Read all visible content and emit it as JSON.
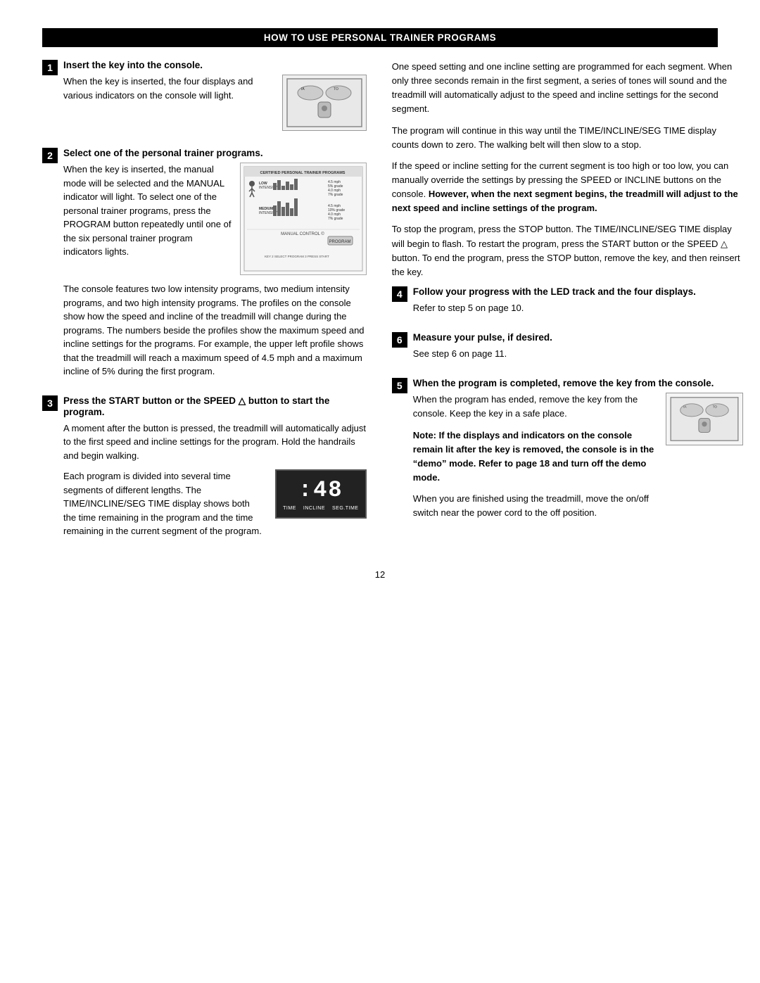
{
  "header": {
    "title": "HOW TO USE PERSONAL TRAINER PROGRAMS"
  },
  "step1": {
    "number": "1",
    "title": "Insert the key into the console.",
    "body": "When the key is inserted, the four displays and various indicators on the console will light."
  },
  "step2": {
    "number": "2",
    "title": "Select one of the personal trainer programs.",
    "body1": "When the key is inserted, the manual mode will be selected and the MANUAL indicator will light. To select one of the personal trainer programs, press the PROGRAM button repeatedly until one of the six personal trainer program indicators lights.",
    "body2": "The console features two low intensity programs, two medium intensity programs, and two high intensity programs. The profiles on the console show how the speed and incline of the treadmill will change during the programs. The numbers beside the profiles show the maximum speed and incline settings for the programs. For example, the upper left profile shows that the treadmill will reach a maximum speed of 4.5 mph and a maximum incline of 5% during the first program."
  },
  "step3": {
    "number": "3",
    "title": "Press the START button or the SPEED △ button to start the program.",
    "body1": "A moment after the button is pressed, the treadmill will automatically adjust to the first speed and incline settings for the program. Hold the handrails and begin walking.",
    "body2": "Each program is divided into several time segments of different lengths. The TIME/INCLINE/SEG TIME display shows both the time remaining in the program and the time remaining in the current segment of the program."
  },
  "right_col": {
    "para1": "One speed setting and one incline setting are programmed for each segment. When only three seconds remain in the first segment, a series of tones will sound and the treadmill will automatically adjust to the speed and incline settings for the second segment.",
    "para2": "The program will continue in this way until the TIME/INCLINE/SEG TIME display counts down to zero. The walking belt will then slow to a stop.",
    "para3": "If the speed or incline setting for the current segment is too high or too low, you can manually override the settings by pressing the SPEED or INCLINE buttons on the console. ",
    "para3_bold": "However, when the next segment begins, the treadmill will adjust to the next speed and incline settings of the program.",
    "para4": "To stop the program, press the STOP button. The TIME/INCLINE/SEG TIME display will begin to flash. To restart the program, press the START button or the SPEED △ button. To end the program, press the STOP button, remove the key, and then reinsert the key.",
    "step4": {
      "number": "4",
      "title": "Follow your progress with the LED track and the four displays.",
      "body": "Refer to step 5 on page 10."
    },
    "step6": {
      "number": "6",
      "title": "Measure your pulse, if desired.",
      "body": "See step 6 on page 11."
    },
    "step5": {
      "number": "5",
      "title": "When the program is completed, remove the key from the console.",
      "body1": "When the program has ended, remove the key from the console. Keep the key in a safe place.",
      "body2_bold": "Note: If the displays and indicators on the console remain lit after the key is removed, the console is in the “demo” mode. Refer to page 18 and turn off the demo mode.",
      "body3": "When you are finished using the treadmill, move the on/off switch near the power cord to the off position."
    }
  },
  "page_number": "12"
}
